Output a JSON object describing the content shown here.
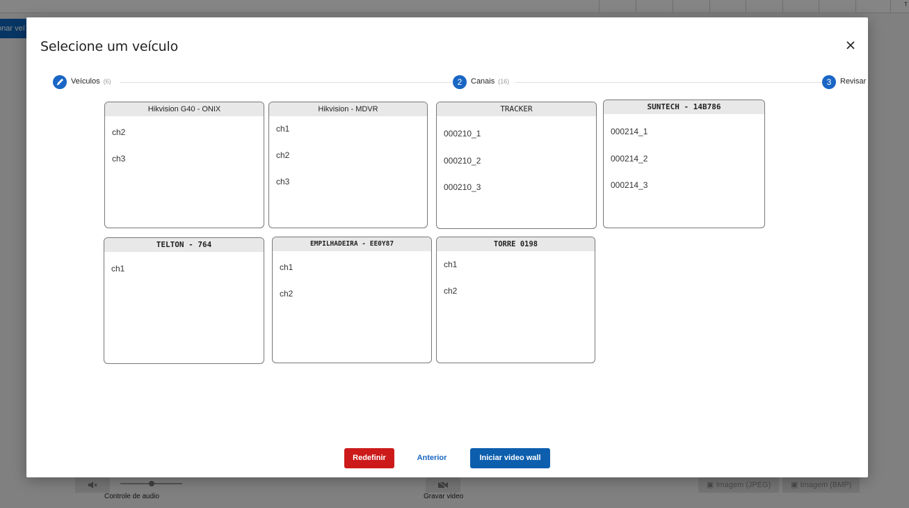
{
  "background": {
    "top_right_letter": "T",
    "left_button_label": "onar veí",
    "audio_label": "Controle de audio",
    "record_label": "Gravar video",
    "image_jpeg_label": "Imagem (JPEG)",
    "image_bmp_label": "Imagem (BMP)"
  },
  "modal": {
    "title": "Selecione um veículo",
    "close_icon": "close-icon"
  },
  "stepper": {
    "steps": [
      {
        "label": "Veículos",
        "count": "(6)",
        "icon": "pencil-icon"
      },
      {
        "label": "Canais",
        "count": "(16)",
        "number": "2"
      },
      {
        "label": "Revisar",
        "number": "3"
      }
    ]
  },
  "cards": [
    {
      "title": "Hikvision G40 - ONIX",
      "channels": [
        "ch2",
        "ch3"
      ]
    },
    {
      "title": "Hikvision - MDVR",
      "channels": [
        "ch1",
        "ch2",
        "ch3"
      ]
    },
    {
      "title": "TRACKER",
      "channels": [
        "000210_1",
        "000210_2",
        "000210_3"
      ]
    },
    {
      "title": "SUNTECH - 14B786",
      "channels": [
        "000214_1",
        "000214_2",
        "000214_3"
      ]
    },
    {
      "title": "TELTON - 764",
      "channels": [
        "ch1"
      ]
    },
    {
      "title": "EMPILHADEIRA - EE0Y87",
      "channels": [
        "ch1",
        "ch2"
      ]
    },
    {
      "title": "TORRE 0198",
      "channels": [
        "ch1",
        "ch2"
      ]
    }
  ],
  "footer": {
    "reset_label": "Redefinir",
    "previous_label": "Anterior",
    "start_label": "Iniciar video wall"
  },
  "colors": {
    "primary": "#1a66c4",
    "danger": "#cc1a1a",
    "start_button": "#0d5fae"
  }
}
